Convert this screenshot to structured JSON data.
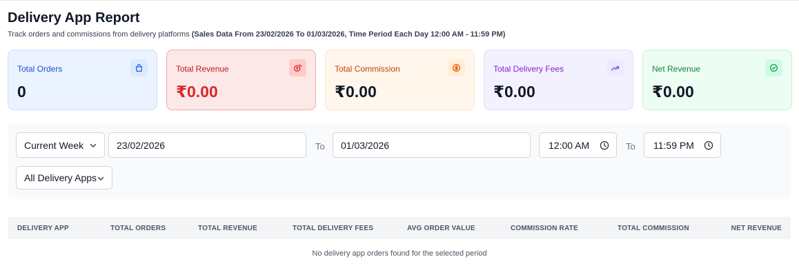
{
  "header": {
    "title": "Delivery App Report",
    "subtitle": "Track orders and commissions from delivery platforms",
    "period": "(Sales Data From 23/02/2026 To 01/03/2026, Time Period Each Day 12:00 AM - 11:59 PM)"
  },
  "cards": [
    {
      "label": "Total Orders",
      "value": "0",
      "icon": "shopping-bag-icon",
      "bg": "#eaf3ff",
      "border": "#cfe2fb",
      "label_color": "#1d4ed8",
      "value_color": "#111827",
      "icon_bg": "#dbeafe",
      "icon_color": "#2563eb"
    },
    {
      "label": "Total Revenue",
      "value": "₹0.00",
      "icon": "coins-icon",
      "bg": "#fde8e8",
      "border": "#f5a9a9",
      "label_color": "#b91c1c",
      "value_color": "#dc2626",
      "icon_bg": "#fecaca",
      "icon_color": "#dc2626"
    },
    {
      "label": "Total Commission",
      "value": "₹0.00",
      "icon": "dollar-circle-icon",
      "bg": "#fff6ec",
      "border": "#fde4c8",
      "label_color": "#c2410c",
      "value_color": "#111827",
      "icon_bg": "#ffedd5",
      "icon_color": "#ea580c"
    },
    {
      "label": "Total Delivery Fees",
      "value": "₹0.00",
      "icon": "trending-up-icon",
      "bg": "#f4f1ff",
      "border": "#e4dcfb",
      "label_color": "#7e22ce",
      "value_color": "#111827",
      "icon_bg": "#ede9fe",
      "icon_color": "#7c3aed"
    },
    {
      "label": "Net Revenue",
      "value": "₹0.00",
      "icon": "check-circle-icon",
      "bg": "#ecfdf3",
      "border": "#c9f0d8",
      "label_color": "#15803d",
      "value_color": "#111827",
      "icon_bg": "#d1fae5",
      "icon_color": "#16a34a"
    }
  ],
  "filters": {
    "range_select": "Current Week",
    "start_date": "23/02/2026",
    "to_label": "To",
    "end_date": "01/03/2026",
    "start_time": "12:00 AM",
    "end_time": "11:59 PM",
    "app_select": "All Delivery Apps"
  },
  "table": {
    "columns": [
      "DELIVERY APP",
      "TOTAL ORDERS",
      "TOTAL REVENUE",
      "TOTAL DELIVERY FEES",
      "AVG ORDER VALUE",
      "COMMISSION RATE",
      "TOTAL COMMISSION",
      "NET REVENUE"
    ],
    "empty_message": "No delivery app orders found for the selected period"
  }
}
